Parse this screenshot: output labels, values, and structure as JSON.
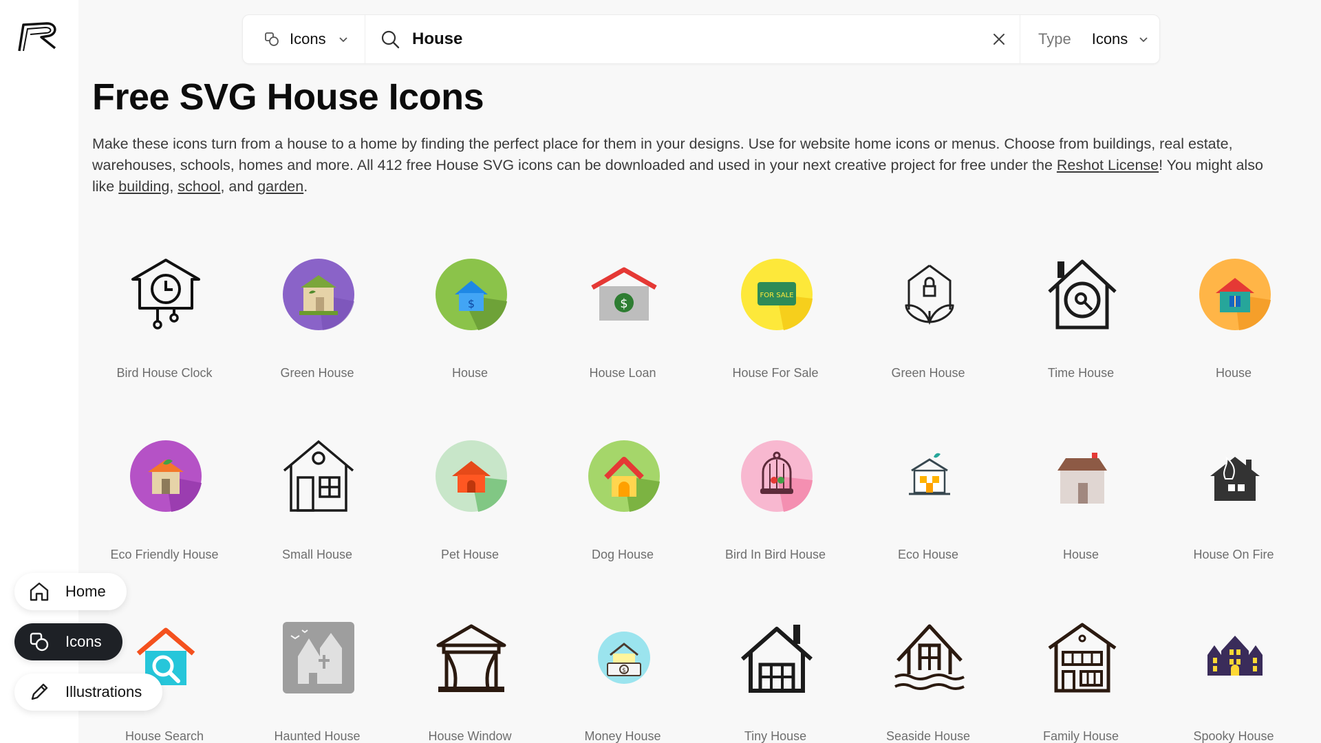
{
  "brand": {
    "logo_text": "R"
  },
  "search": {
    "type_label": "Icons",
    "query": "House",
    "filter_label": "Type",
    "filter_value": "Icons"
  },
  "page": {
    "title": "Free SVG House Icons",
    "desc_1": "Make these icons turn from a house to a home by finding the perfect place for them in your designs. Use for website home icons or menus. Choose from buildings, real estate, warehouses, schools, homes and more. All 412 free House SVG icons can be downloaded and used in your next creative project for free under the ",
    "license_link": "Reshot License",
    "desc_2": "! You might also like ",
    "related": [
      "building",
      "school",
      "garden"
    ],
    "sep_1": ", ",
    "sep_2": ", and ",
    "end": "."
  },
  "icons": [
    {
      "name": "Bird House Clock",
      "icon": "bird-house-clock-icon"
    },
    {
      "name": "Green House",
      "icon": "green-house-icon"
    },
    {
      "name": "House",
      "icon": "house-green-circle-icon"
    },
    {
      "name": "House Loan",
      "icon": "house-loan-icon"
    },
    {
      "name": "House For Sale",
      "icon": "house-for-sale-icon"
    },
    {
      "name": "Green House",
      "icon": "green-house-leaf-icon"
    },
    {
      "name": "Time House",
      "icon": "time-house-icon"
    },
    {
      "name": "House",
      "icon": "house-orange-circle-icon"
    },
    {
      "name": "Eco Friendly House",
      "icon": "eco-friendly-house-icon"
    },
    {
      "name": "Small House",
      "icon": "small-house-icon"
    },
    {
      "name": "Pet House",
      "icon": "pet-house-icon"
    },
    {
      "name": "Dog House",
      "icon": "dog-house-icon"
    },
    {
      "name": "Bird In Bird House",
      "icon": "bird-cage-icon"
    },
    {
      "name": "Eco House",
      "icon": "eco-house-icon"
    },
    {
      "name": "House",
      "icon": "house-brown-roof-icon"
    },
    {
      "name": "House On Fire",
      "icon": "house-on-fire-icon"
    },
    {
      "name": "House Search",
      "icon": "house-search-icon"
    },
    {
      "name": "Haunted House",
      "icon": "haunted-house-icon"
    },
    {
      "name": "House Window",
      "icon": "house-window-icon"
    },
    {
      "name": "Money House",
      "icon": "money-house-icon"
    },
    {
      "name": "Tiny House",
      "icon": "tiny-house-icon"
    },
    {
      "name": "Seaside House",
      "icon": "seaside-house-icon"
    },
    {
      "name": "Family House",
      "icon": "family-house-icon"
    },
    {
      "name": "Spooky House",
      "icon": "spooky-house-icon"
    }
  ],
  "nav": {
    "home": "Home",
    "icons": "Icons",
    "illustrations": "Illustrations"
  }
}
